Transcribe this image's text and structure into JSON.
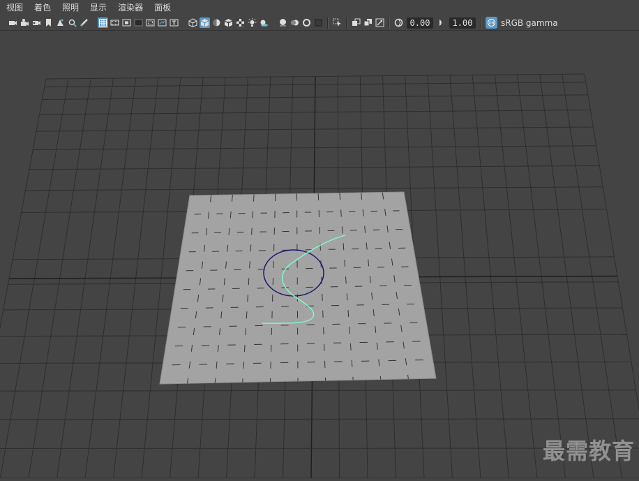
{
  "menu": {
    "items": [
      "视图",
      "着色",
      "照明",
      "显示",
      "渲染器",
      "面板"
    ]
  },
  "toolbar": {
    "exposure_value": "0.00",
    "gamma_value": "1.00",
    "color_space_label": "sRGB gamma",
    "icons": [
      "select-camera-icon",
      "camera-attributes-icon",
      "bookmark-icon",
      "image-plane-icon",
      "2d-pan-zoom-icon",
      "grease-pencil-icon",
      "grid-icon",
      "film-gate-icon",
      "resolution-gate-icon",
      "gate-mask-icon",
      "field-chart-icon",
      "safe-action-icon",
      "safe-title-icon",
      "wireframe-icon",
      "smooth-shade-icon",
      "default-material-icon",
      "wireframe-on-shaded-icon",
      "textured-icon",
      "use-lights-icon",
      "shadows-icon",
      "screen-space-ao-icon",
      "motion-blur-icon",
      "anti-alias-icon",
      "depth-of-field-icon",
      "isolate-select-icon",
      "xray-icon",
      "xray-joints-icon",
      "xray-components-icon",
      "exposure-icon",
      "gamma-icon",
      "color-management-icon"
    ]
  },
  "accent_color": "#5c97c6",
  "curve_color": "#7dffc8",
  "circle_color": "#1a1a6e",
  "watermark": "最需教育"
}
